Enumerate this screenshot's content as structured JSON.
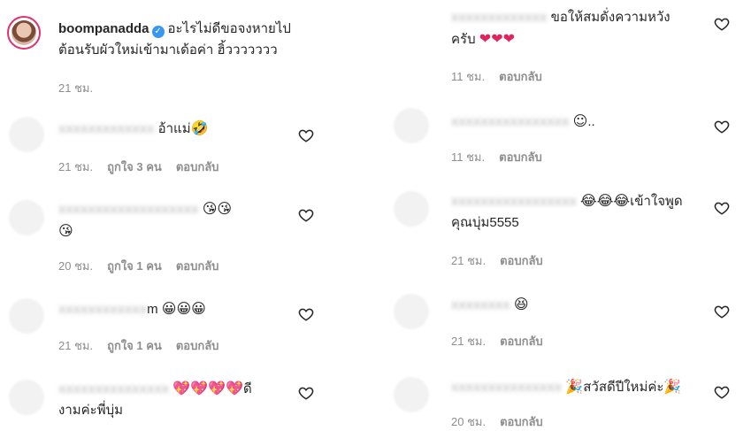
{
  "left_column": {
    "main_comment": {
      "username": "boompanadda",
      "text_line1": "อะไรไม่ดีขอจงหายไป",
      "text_line2": "ต้อนรับผัวใหม่เข้ามาเด้อค่า ฮิ้ววววววว",
      "time": "21 ชม."
    },
    "replies": [
      {
        "username": "",
        "text": "อ้าแม่",
        "emoji": "🤣",
        "time": "21 ชม.",
        "likes": "ถูกใจ 3 คน",
        "reply": "ตอบกลับ"
      },
      {
        "username": "",
        "text": "",
        "emoji": "😘😘",
        "emoji2": "😘",
        "time": "20 ชม.",
        "likes": "ถูกใจ 1 คน",
        "reply": "ตอบกลับ"
      },
      {
        "username": "",
        "text": "m",
        "emoji": "😀😀😀",
        "time": "21 ชม.",
        "likes": "ถูกใจ 1 คน",
        "reply": "ตอบกลับ"
      },
      {
        "username": "",
        "text": "ดี",
        "emoji": "💖💖💖💖",
        "text_line2": "งามค่ะพี่บุ่ม"
      }
    ]
  },
  "right_column": {
    "comments": [
      {
        "text_line1": "ขอให้สมดั่งความหวัง",
        "text_line2": "ครับ",
        "emoji": "❤❤❤",
        "time": "11 ชม.",
        "reply": "ตอบกลับ"
      },
      {
        "text": "..",
        "emoji": "☺",
        "time": "11 ชม.",
        "reply": "ตอบกลับ"
      },
      {
        "text": "เข้าใจพูด",
        "emoji": "😂😂😂",
        "text_line2": "คุณบุ่ม5555",
        "time": "21 ชม.",
        "reply": "ตอบกลับ"
      },
      {
        "emoji": "😆",
        "time": "21 ชม.",
        "reply": "ตอบกลับ"
      },
      {
        "text": "สวัสดีปีใหม่ค่ะ",
        "emoji": "🎉",
        "emoji2": "🎉",
        "time": "20 ชม.",
        "reply": "ตอบกลับ"
      }
    ]
  },
  "colors": {
    "heart_outline": "#262626",
    "meta_text": "#8e8e8e",
    "story_ring": "#e1306c",
    "verified": "#3897f0"
  },
  "icons": {
    "like": "heart-outline-icon",
    "verified": "verified-badge-icon"
  }
}
